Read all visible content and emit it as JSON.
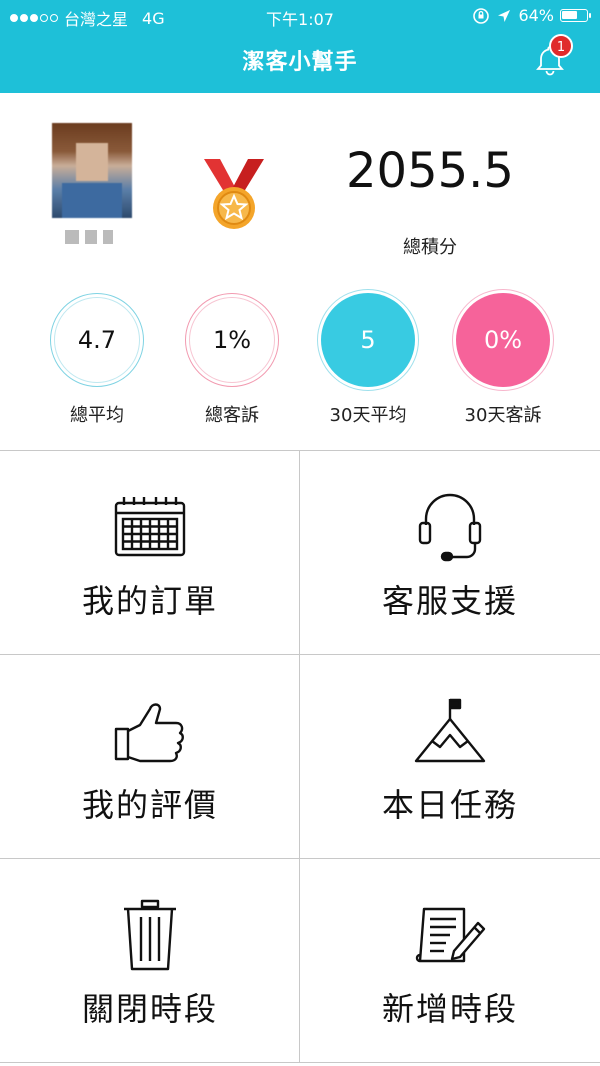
{
  "status_bar": {
    "carrier": "台灣之星",
    "network": "4G",
    "time": "下午1:07",
    "battery": "64%",
    "battery_level": 0.64
  },
  "nav": {
    "title": "潔客小幫手",
    "notification_count": "1"
  },
  "profile": {
    "score": "2055.5",
    "score_label": "總積分"
  },
  "stats": [
    {
      "value": "4.7",
      "label": "總平均"
    },
    {
      "value": "1%",
      "label": "總客訴"
    },
    {
      "value": "5",
      "label": "30天平均"
    },
    {
      "value": "0%",
      "label": "30天客訴"
    }
  ],
  "menu": [
    {
      "label": "我的訂單",
      "icon": "calendar-icon"
    },
    {
      "label": "客服支援",
      "icon": "headset-icon"
    },
    {
      "label": "我的評價",
      "icon": "thumbs-up-icon"
    },
    {
      "label": "本日任務",
      "icon": "mountain-flag-icon"
    },
    {
      "label": "關閉時段",
      "icon": "trash-icon"
    },
    {
      "label": "新增時段",
      "icon": "document-edit-icon"
    }
  ],
  "colors": {
    "header": "#1ec0d8",
    "accent_blue": "#38cbe2",
    "accent_pink": "#f6639a",
    "badge": "#e02b2b"
  }
}
